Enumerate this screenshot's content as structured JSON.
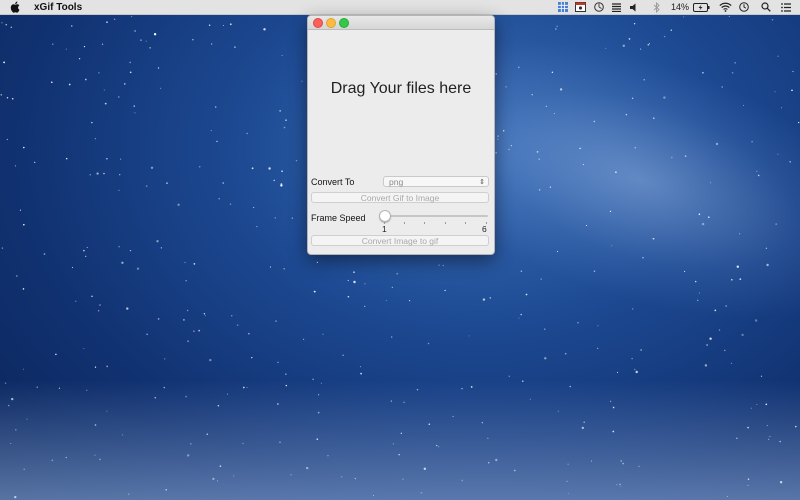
{
  "menubar": {
    "app_name": "xGif Tools",
    "battery_percent": "14%",
    "icons": [
      "apple-icon",
      "grid-status-icon",
      "screen-record-icon",
      "clock-status-icon",
      "list-status-icon",
      "volume-icon",
      "bluetooth-icon",
      "battery-icon",
      "wifi-icon",
      "time-machine-icon",
      "spotlight-icon",
      "notification-center-icon"
    ]
  },
  "window": {
    "drop_text": "Drag Your files here",
    "convert_to_label": "Convert To",
    "format_select_value": "png",
    "convert_gif_button": "Convert Gif to Image",
    "frame_speed_label": "Frame Speed",
    "slider_min_label": "1",
    "slider_max_label": "6",
    "slider_value": 1,
    "convert_image_button": "Convert Image to gif"
  },
  "colors": {
    "close": "#fc605b",
    "minimize": "#fdbc40",
    "zoom": "#34c84a",
    "desktop": "#1d4a93"
  }
}
